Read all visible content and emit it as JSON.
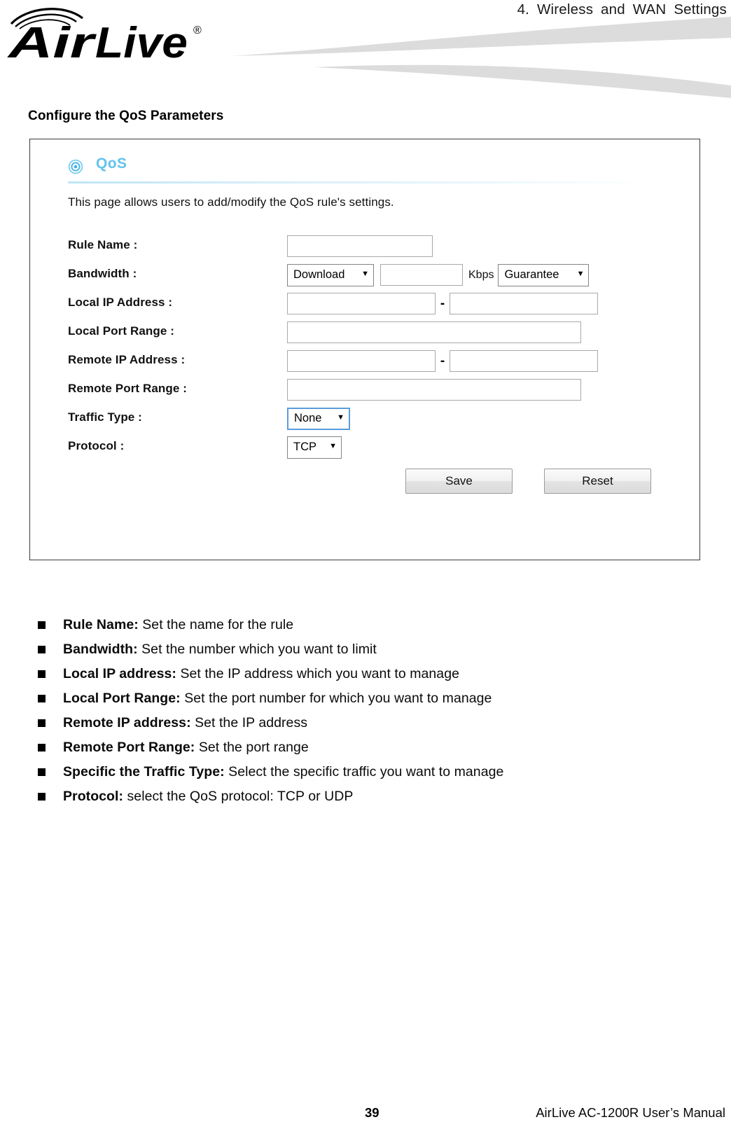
{
  "header": {
    "chapter_title": "4.  Wireless  and  WAN  Settings",
    "brand": "AirLive",
    "brand_mark": "®"
  },
  "section": {
    "heading": "Configure the QoS Parameters"
  },
  "qos_panel": {
    "icon": "target-icon",
    "title": "QoS",
    "description": "This page allows users to add/modify the QoS rule's settings.",
    "accent_color": "#62c3ec",
    "focus_color": "#5b9ddb",
    "rows": [
      {
        "label": "Rule Name :",
        "fields": [
          {
            "kind": "text",
            "name": "rule-name-input",
            "value": "",
            "placeholder": ""
          }
        ]
      },
      {
        "label": "Bandwidth :",
        "fields": [
          {
            "kind": "select",
            "name": "bandwidth-direction-select",
            "value": "Download"
          },
          {
            "kind": "text",
            "name": "bandwidth-value-input",
            "value": "",
            "placeholder": ""
          },
          {
            "kind": "unit",
            "name": "bandwidth-unit-label",
            "value": "Kbps"
          },
          {
            "kind": "select",
            "name": "bandwidth-mode-select",
            "value": "Guarantee"
          }
        ]
      },
      {
        "label": "Local IP Address :",
        "fields": [
          {
            "kind": "text",
            "name": "local-ip-start-input",
            "value": "",
            "placeholder": ""
          },
          {
            "kind": "dash",
            "name": "range-separator",
            "value": "-"
          },
          {
            "kind": "text",
            "name": "local-ip-end-input",
            "value": "",
            "placeholder": ""
          }
        ]
      },
      {
        "label": "Local Port Range :",
        "fields": [
          {
            "kind": "text",
            "name": "local-port-range-input",
            "value": "",
            "placeholder": ""
          }
        ]
      },
      {
        "label": "Remote IP Address :",
        "fields": [
          {
            "kind": "text",
            "name": "remote-ip-start-input",
            "value": "",
            "placeholder": ""
          },
          {
            "kind": "dash",
            "name": "range-separator",
            "value": "-"
          },
          {
            "kind": "text",
            "name": "remote-ip-end-input",
            "value": "",
            "placeholder": ""
          }
        ]
      },
      {
        "label": "Remote Port Range :",
        "fields": [
          {
            "kind": "text",
            "name": "remote-port-range-input",
            "value": "",
            "placeholder": ""
          }
        ]
      },
      {
        "label": "Traffic Type :",
        "fields": [
          {
            "kind": "select",
            "name": "traffic-type-select",
            "value": "None",
            "focused": true
          }
        ]
      },
      {
        "label": "Protocol :",
        "fields": [
          {
            "kind": "select",
            "name": "protocol-select",
            "value": "TCP"
          }
        ]
      }
    ],
    "buttons": {
      "save_label": "Save",
      "reset_label": "Reset"
    }
  },
  "feature_list": [
    {
      "term": "Rule Name:",
      "description": "Set the name for the rule"
    },
    {
      "term": "Bandwidth:",
      "description": "Set the number which you want to limit"
    },
    {
      "term": "Local IP address:",
      "description": "Set the IP address which you want to manage"
    },
    {
      "term": "Local Port Range:",
      "description": "Set the port number for which you want to manage"
    },
    {
      "term": "Remote IP address:",
      "description": "Set the IP address"
    },
    {
      "term": "Remote Port Range:",
      "description": "Set the port range"
    },
    {
      "term": "Specific the Traffic Type:",
      "description": "Select the specific traffic you want to manage"
    },
    {
      "term": "Protocol:",
      "description": "select the QoS protocol: TCP or UDP"
    }
  ],
  "footer": {
    "page_number": "39",
    "manual_title": "AirLive AC-1200R User’s Manual"
  }
}
